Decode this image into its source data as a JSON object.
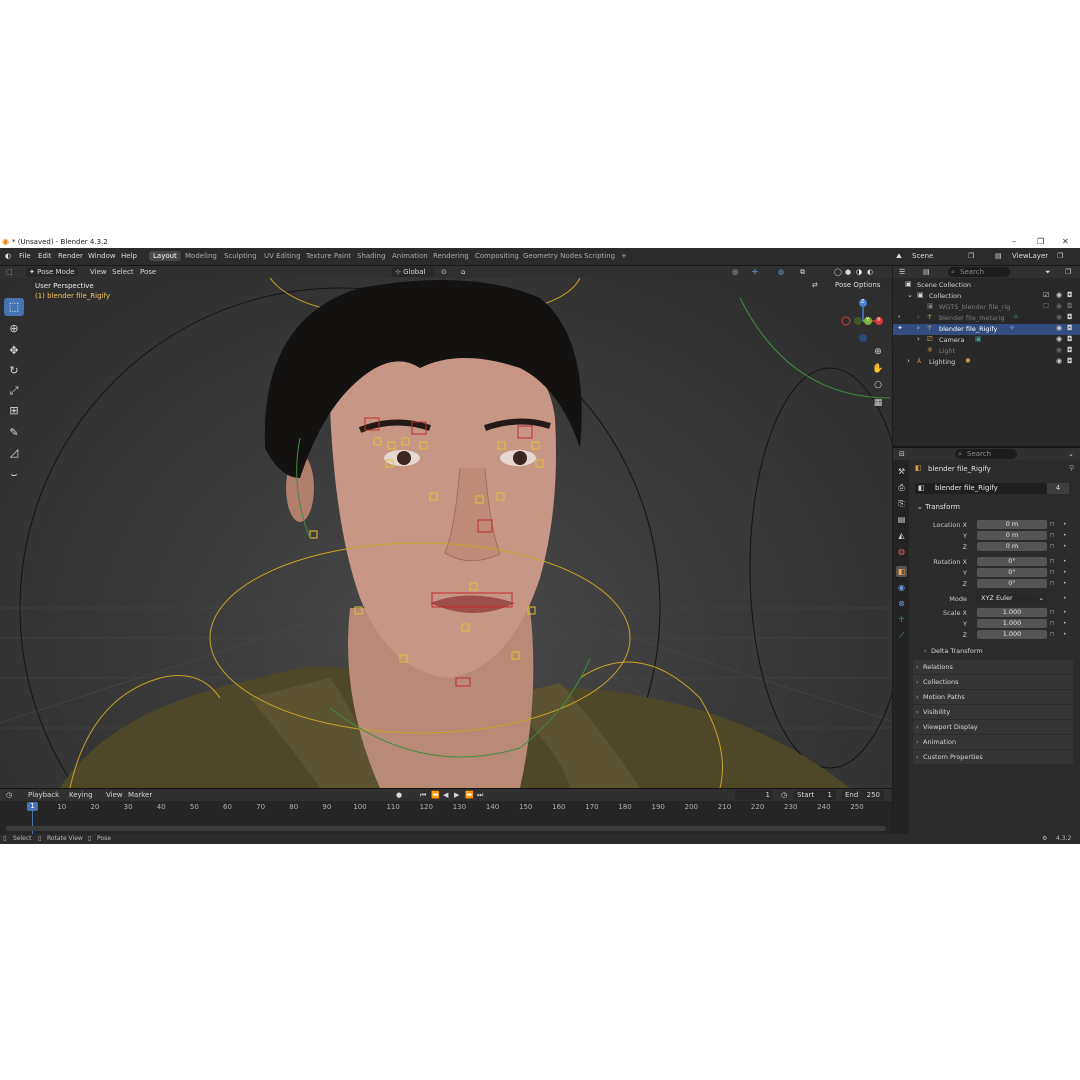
{
  "window": {
    "title": "* (Unsaved) - Blender 4.3.2"
  },
  "menu": [
    "File",
    "Edit",
    "Render",
    "Window",
    "Help"
  ],
  "workspace_tabs": [
    "Layout",
    "Modeling",
    "Sculpting",
    "UV Editing",
    "Texture Paint",
    "Shading",
    "Animation",
    "Rendering",
    "Compositing",
    "Geometry Nodes",
    "Scripting"
  ],
  "active_tab": "Layout",
  "viewport_header": {
    "mode": "Pose Mode",
    "menus": [
      "View",
      "Select",
      "Pose"
    ],
    "orientation": "Global",
    "pose_options": "Pose Options"
  },
  "viewport": {
    "perspective": "User Perspective",
    "active_object": "(1) blender file_Rigify",
    "gizmo_axes": [
      "X",
      "Y",
      "Z"
    ]
  },
  "timeline": {
    "menus": [
      "Playback",
      "Keying",
      "View",
      "Marker"
    ],
    "current_frame": "1",
    "start_label": "Start",
    "start": "1",
    "end_label": "End",
    "end": "250",
    "ticks": [
      "1",
      "10",
      "20",
      "30",
      "40",
      "50",
      "60",
      "70",
      "80",
      "90",
      "100",
      "110",
      "120",
      "130",
      "140",
      "150",
      "160",
      "170",
      "180",
      "190",
      "200",
      "210",
      "220",
      "230",
      "240",
      "250"
    ]
  },
  "statusbar": {
    "items": [
      "Select",
      "Rotate View",
      "Pose"
    ],
    "version": "4.3.2"
  },
  "scene_header": {
    "scene": "Scene",
    "view_layer": "ViewLayer"
  },
  "outliner": {
    "search_placeholder": "Search",
    "rows": [
      {
        "label": "Scene Collection",
        "indent": 0,
        "state": "normal"
      },
      {
        "label": "Collection",
        "indent": 1,
        "state": "normal"
      },
      {
        "label": "WGTS_blender file_rig",
        "indent": 2,
        "state": "dim"
      },
      {
        "label": "blender file_metarig",
        "indent": 2,
        "state": "dim"
      },
      {
        "label": "blender file_Rigify",
        "indent": 2,
        "state": "selected"
      },
      {
        "label": "Camera",
        "indent": 2,
        "state": "normal"
      },
      {
        "label": "Light",
        "indent": 2,
        "state": "dim"
      },
      {
        "label": "Lighting",
        "indent": 1,
        "state": "normal"
      }
    ]
  },
  "properties": {
    "search_placeholder": "Search",
    "object_name": "blender file_Rigify",
    "data_name": "blender file_Rigify",
    "users": "4",
    "transform_label": "Transform",
    "location_label": "Location X",
    "location": [
      "0 m",
      "0 m",
      "0 m"
    ],
    "rotation_label": "Rotation X",
    "rotation": [
      "0°",
      "0°",
      "0°"
    ],
    "mode_label": "Mode",
    "mode": "XYZ Euler",
    "scale_label": "Scale X",
    "scale": [
      "1.000",
      "1.000",
      "1.000"
    ],
    "axis_y": "Y",
    "axis_z": "Z",
    "delta_transform": "Delta Transform",
    "panels": [
      "Relations",
      "Collections",
      "Motion Paths",
      "Visibility",
      "Viewport Display",
      "Animation",
      "Custom Properties"
    ]
  }
}
